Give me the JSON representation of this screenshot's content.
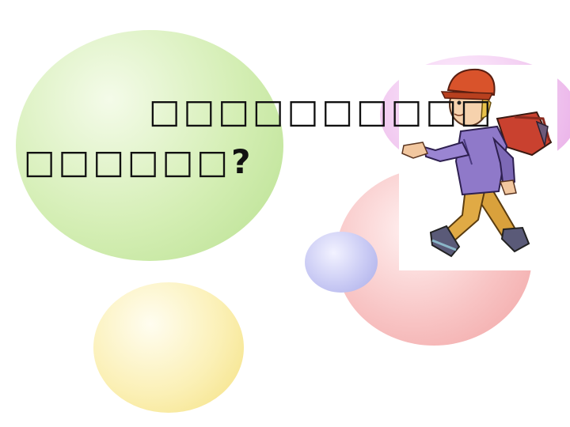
{
  "question": {
    "line1": "□□□□□□□□□□",
    "line2": "□□□□□□?"
  },
  "illustration": {
    "subject": "boy-walking-with-backpack-icon"
  },
  "colors": {
    "bubble_green": "#c8e8a4",
    "bubble_yellow": "#f8ea9e",
    "bubble_red": "#f4b4b4",
    "bubble_blue": "#b9bbef",
    "bubble_purple": "#eebaed",
    "cap": "#d9532b",
    "sweater": "#8f79c9",
    "pants": "#d9a13c"
  }
}
